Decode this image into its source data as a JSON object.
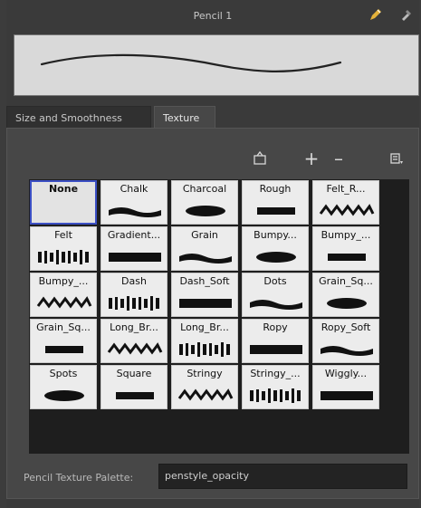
{
  "title": "Pencil 1",
  "tabs": [
    {
      "label": "Size and Smoothness",
      "active": false
    },
    {
      "label": "Texture",
      "active": true
    }
  ],
  "toolbar": {
    "import_icon": "import-texture-icon",
    "add_icon": "plus-icon",
    "remove_icon": "minus-icon",
    "menu_icon": "menu-icon"
  },
  "textures": [
    "None",
    "Chalk",
    "Charcoal",
    "Rough",
    "Felt_R...",
    "Felt",
    "Gradient...",
    "Grain",
    "Bumpy...",
    "Bumpy_...",
    "Bumpy_...",
    "Dash",
    "Dash_Soft",
    "Dots",
    "Grain_Sq...",
    "Grain_Sq...",
    "Long_Br...",
    "Long_Br...",
    "Ropy",
    "Ropy_Soft",
    "Spots",
    "Square",
    "Stringy",
    "Stringy_...",
    "Wiggly..."
  ],
  "selected_texture": "None",
  "palette": {
    "label": "Pencil Texture Palette:",
    "value": "penstyle_opacity"
  },
  "colors": {
    "selection": "#3b4fc4",
    "panel": "#474747"
  }
}
